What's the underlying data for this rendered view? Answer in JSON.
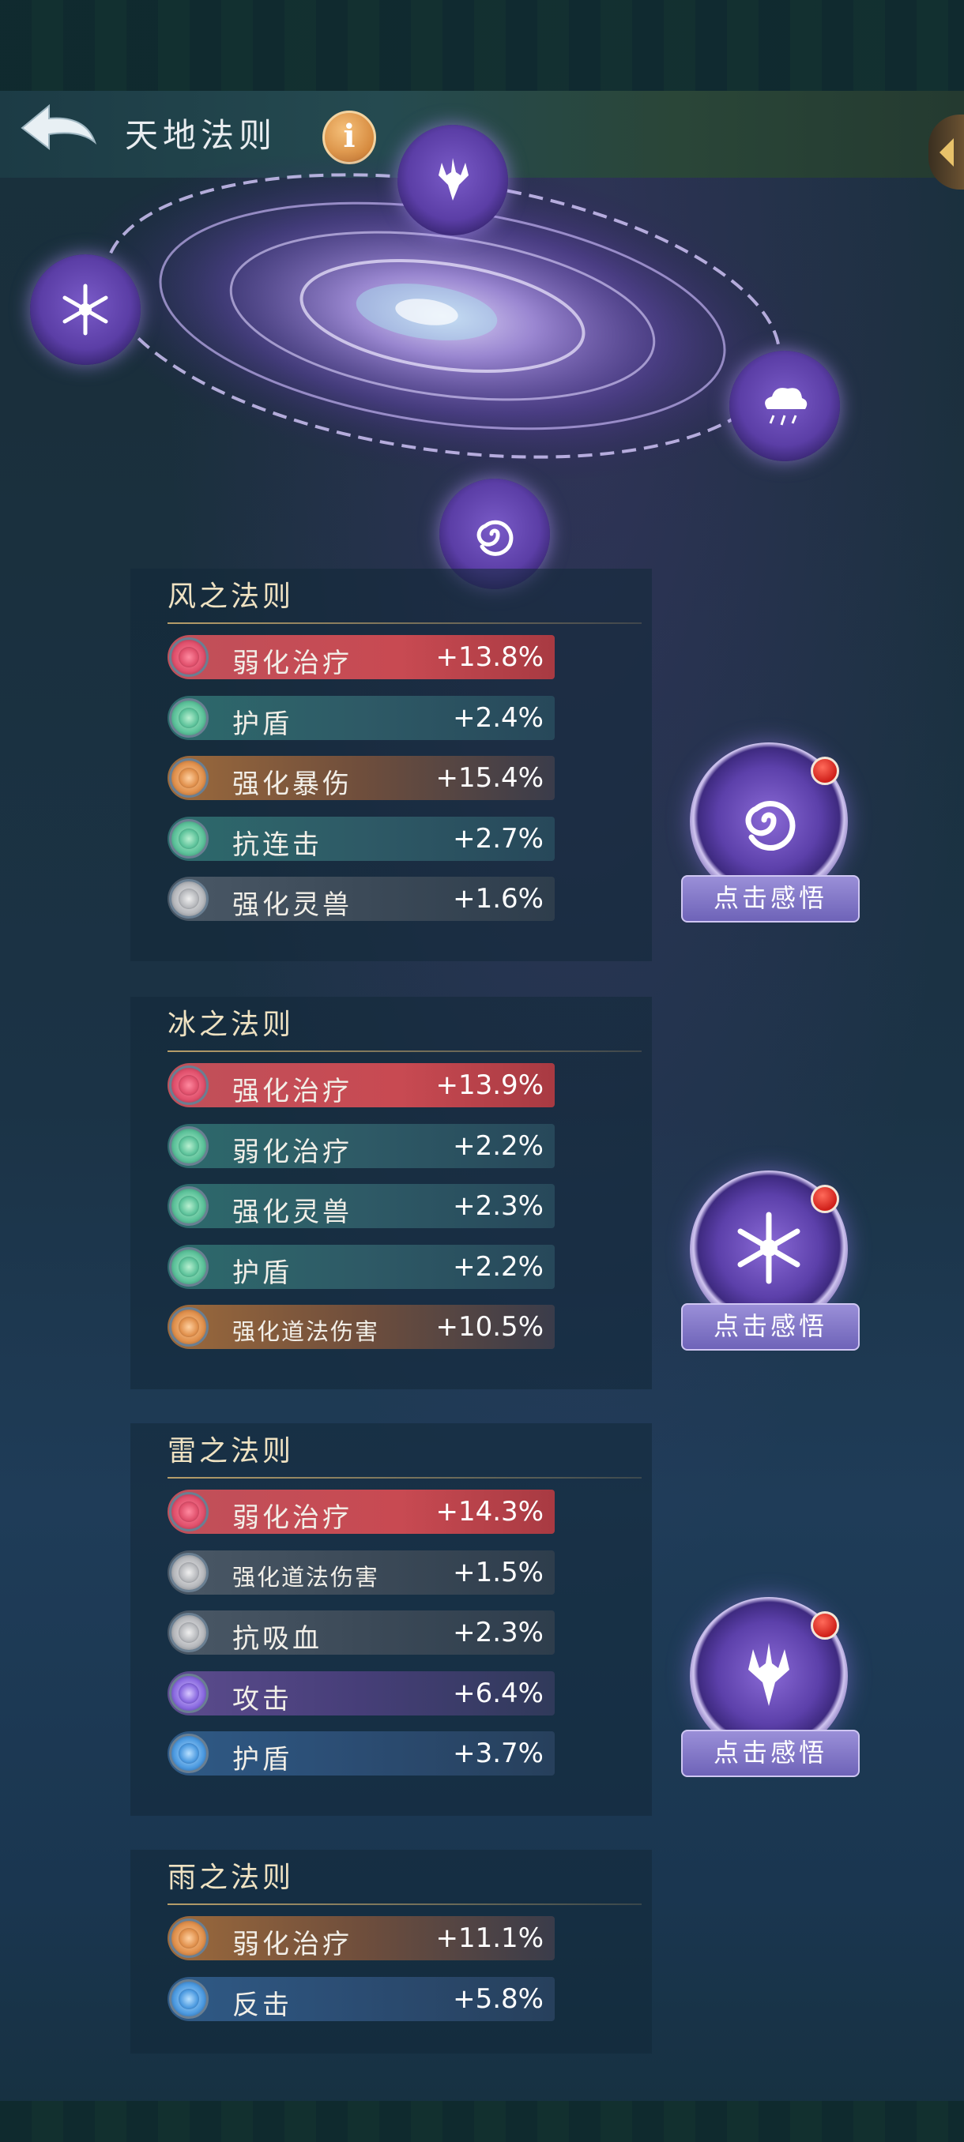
{
  "header": {
    "title": "天地法则",
    "info_glyph": "i"
  },
  "galaxy": {
    "icons": [
      "thunder-icon",
      "snowflake-icon",
      "cloud-rain-icon",
      "wind-swirl-icon"
    ]
  },
  "sections": [
    {
      "title": "风之法则",
      "button_label": "点击感悟",
      "icon": "wind-swirl-icon",
      "has_notification": true,
      "rows": [
        {
          "label": "弱化治疗",
          "value": "+13.8%",
          "tier": "red"
        },
        {
          "label": "护盾",
          "value": "+2.4%",
          "tier": "green"
        },
        {
          "label": "强化暴伤",
          "value": "+15.4%",
          "tier": "orange"
        },
        {
          "label": "抗连击",
          "value": "+2.7%",
          "tier": "green"
        },
        {
          "label": "强化灵兽",
          "value": "+1.6%",
          "tier": "gray"
        }
      ]
    },
    {
      "title": "冰之法则",
      "button_label": "点击感悟",
      "icon": "snowflake-icon",
      "has_notification": true,
      "rows": [
        {
          "label": "强化治疗",
          "value": "+13.9%",
          "tier": "red"
        },
        {
          "label": "弱化治疗",
          "value": "+2.2%",
          "tier": "green"
        },
        {
          "label": "强化灵兽",
          "value": "+2.3%",
          "tier": "green"
        },
        {
          "label": "护盾",
          "value": "+2.2%",
          "tier": "green"
        },
        {
          "label": "强化道法伤害",
          "value": "+10.5%",
          "tier": "orange"
        }
      ]
    },
    {
      "title": "雷之法则",
      "button_label": "点击感悟",
      "icon": "thunder-icon",
      "has_notification": true,
      "rows": [
        {
          "label": "弱化治疗",
          "value": "+14.3%",
          "tier": "red"
        },
        {
          "label": "强化道法伤害",
          "value": "+1.5%",
          "tier": "gray"
        },
        {
          "label": "抗吸血",
          "value": "+2.3%",
          "tier": "gray"
        },
        {
          "label": "攻击",
          "value": "+6.4%",
          "tier": "purple"
        },
        {
          "label": "护盾",
          "value": "+3.7%",
          "tier": "blue"
        }
      ]
    },
    {
      "title": "雨之法则",
      "rows": [
        {
          "label": "弱化治疗",
          "value": "+11.1%",
          "tier": "orange"
        },
        {
          "label": "反击",
          "value": "+5.8%",
          "tier": "blue"
        }
      ]
    }
  ]
}
